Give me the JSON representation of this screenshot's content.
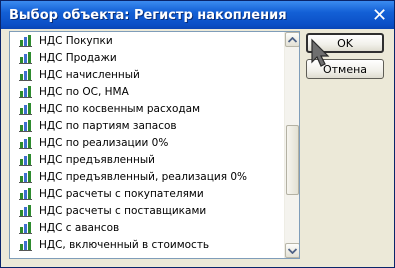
{
  "window": {
    "title": "Выбор объекта: Регистр накопления",
    "close_symbol": "✕"
  },
  "list": {
    "items": [
      {
        "label": "НДС Покупки",
        "icon": "register-icon"
      },
      {
        "label": "НДС Продажи",
        "icon": "register-icon"
      },
      {
        "label": "НДС начисленный",
        "icon": "register-icon"
      },
      {
        "label": "НДС по ОС, НМА",
        "icon": "register-icon"
      },
      {
        "label": "НДС по косвенным расходам",
        "icon": "register-icon"
      },
      {
        "label": "НДС по партиям запасов",
        "icon": "register-icon"
      },
      {
        "label": "НДС по реализации 0%",
        "icon": "register-icon"
      },
      {
        "label": "НДС предъявленный",
        "icon": "register-icon"
      },
      {
        "label": "НДС предъявленный, реализация 0%",
        "icon": "register-icon"
      },
      {
        "label": "НДС расчеты с покупателями",
        "icon": "register-icon"
      },
      {
        "label": "НДС расчеты с поставщиками",
        "icon": "register-icon"
      },
      {
        "label": "НДС с авансов",
        "icon": "register-icon"
      },
      {
        "label": "НДС, включенный в стоимость",
        "icon": "register-icon"
      }
    ]
  },
  "buttons": {
    "ok_label": "OK",
    "cancel_label": "Отмена"
  },
  "colors": {
    "title_bar": "#0b4fc6",
    "dialog_bg": "#ece9d8",
    "list_border": "#7f9db9",
    "icon_green": "#2e8b2e",
    "icon_blue": "#3f6fcf"
  }
}
